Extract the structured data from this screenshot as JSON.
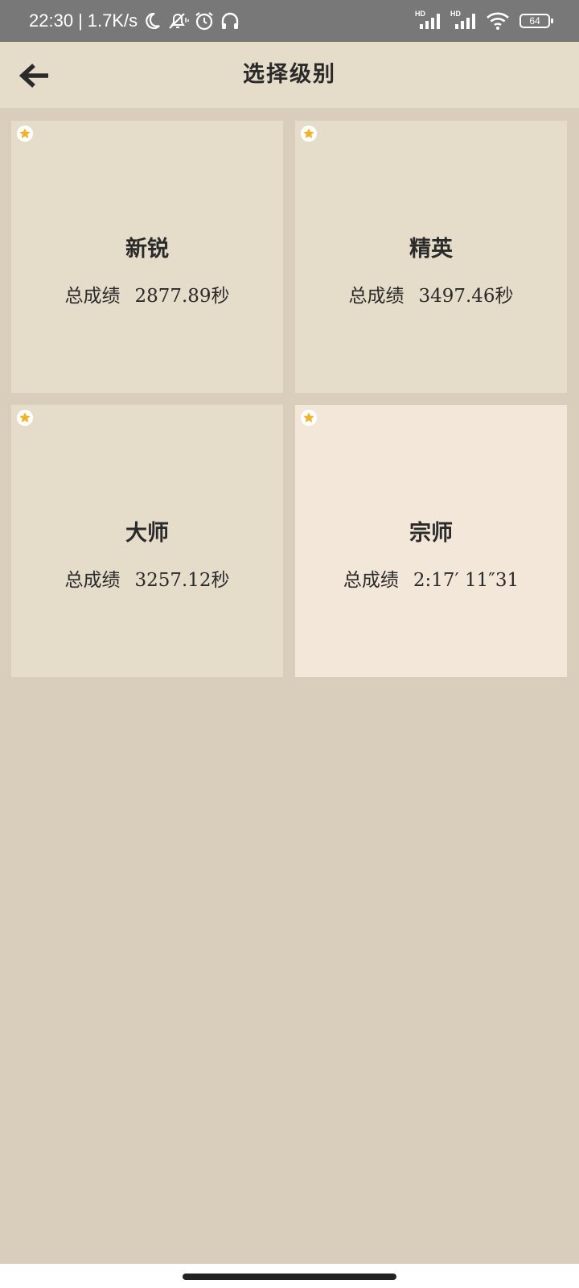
{
  "status_bar": {
    "time": "22:30",
    "separator": "|",
    "net_speed": "1.7K/s",
    "hd1": "HD",
    "hd2": "HD",
    "battery": "64",
    "icons": [
      "moon-icon",
      "mute-icon",
      "alarm-icon",
      "headphones-icon",
      "signal-icon",
      "signal-icon",
      "wifi-icon",
      "battery-icon"
    ]
  },
  "app_bar": {
    "back_icon": "arrow-left-icon",
    "title": "选择级别"
  },
  "levels": [
    {
      "name": "新锐",
      "score_label": "总成绩",
      "score_value": "2877.89秒",
      "starred": true
    },
    {
      "name": "精英",
      "score_label": "总成绩",
      "score_value": "3497.46秒",
      "starred": true
    },
    {
      "name": "大师",
      "score_label": "总成绩",
      "score_value": "3257.12秒",
      "starred": true
    },
    {
      "name": "宗师",
      "score_label": "总成绩",
      "score_value": "2:17′ 11″31",
      "starred": true
    }
  ],
  "colors": {
    "background": "#d9cebb",
    "card": "#e6dcca",
    "card_highlight": "#f2e7d8",
    "star": "#f2b32a",
    "text": "#2a2a2a"
  }
}
